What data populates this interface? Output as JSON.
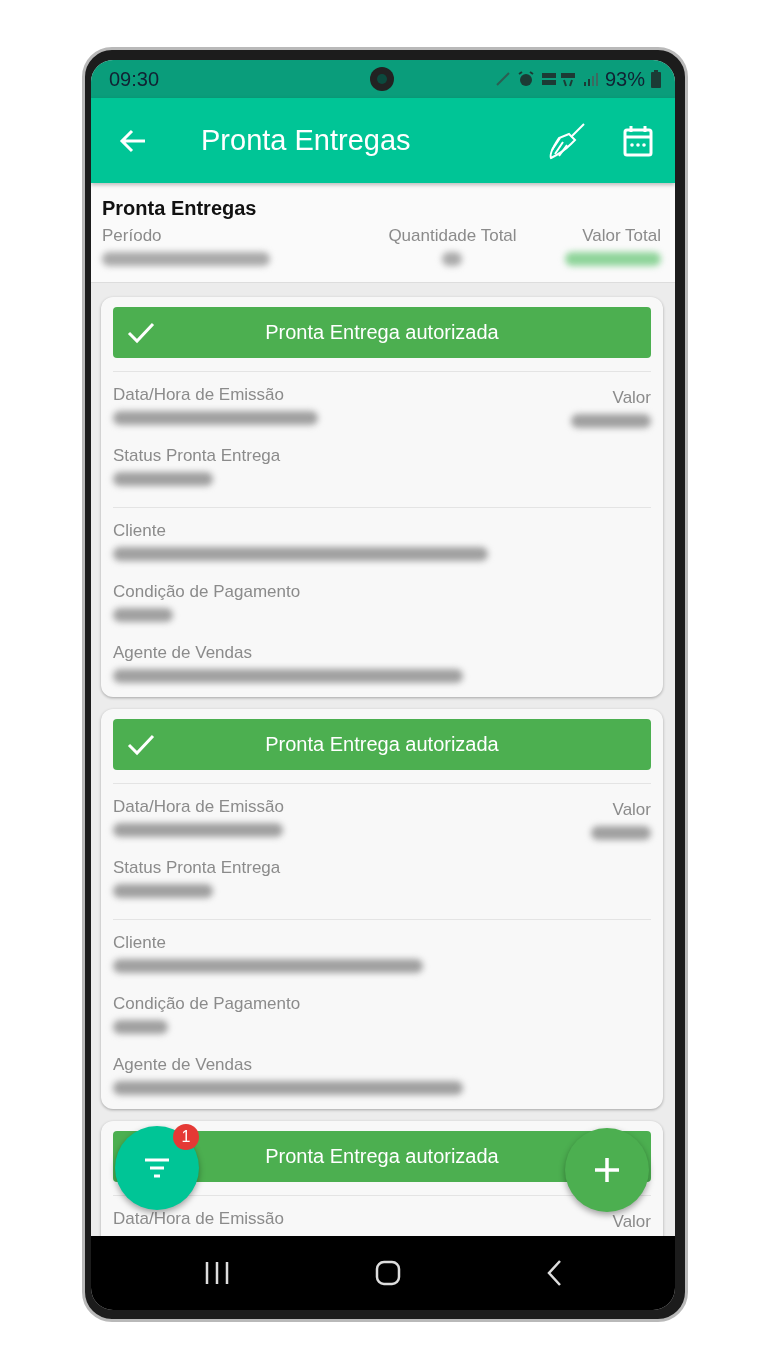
{
  "status_bar": {
    "time": "09:30",
    "battery": "93%"
  },
  "app_bar": {
    "title": "Pronta Entregas"
  },
  "summary": {
    "title": "Pronta Entregas",
    "columns": [
      {
        "label": "Período"
      },
      {
        "label": "Quantidade Total"
      },
      {
        "label": "Valor Total"
      }
    ]
  },
  "cards": [
    {
      "kind": "full",
      "banner": "Pronta Entrega autorizada",
      "date_label": "Data/Hora de Emissão",
      "value_label": "Valor",
      "status_label": "Status Pronta Entrega",
      "client_label": "Cliente",
      "payment_label": "Condição de Pagamento",
      "agent_label": "Agente de Vendas"
    },
    {
      "kind": "full",
      "banner": "Pronta Entrega autorizada",
      "date_label": "Data/Hora de Emissão",
      "value_label": "Valor",
      "status_label": "Status Pronta Entrega",
      "client_label": "Cliente",
      "payment_label": "Condição de Pagamento",
      "agent_label": "Agente de Vendas"
    },
    {
      "kind": "partial",
      "banner": "Pronta Entrega autorizada",
      "date_label": "Data/Hora de Emissão",
      "value_label": "Valor"
    }
  ],
  "filter_fab": {
    "badge": "1"
  }
}
